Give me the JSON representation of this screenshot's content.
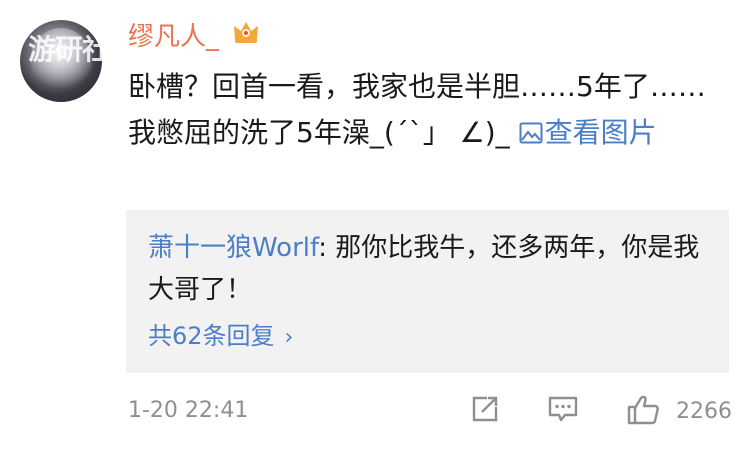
{
  "user": {
    "name": "缪凡人_",
    "watermark": "游研社"
  },
  "comment": {
    "text": "卧槽？回首一看，我家也是半胆……5年了……我憋屈的洗了5年澡_(´`」 ∠)_",
    "view_pic_label": "查看图片"
  },
  "reply": {
    "author": "萧十一狼Worlf",
    "separator": ": ",
    "text": "那你比我牛，还多两年，你是我大哥了！",
    "count_label": "共62条回复",
    "chevron": "›"
  },
  "footer": {
    "timestamp": "1-20 22:41",
    "like_count": "2266"
  },
  "colors": {
    "username": "#eb7350",
    "link": "#4c7ec7",
    "meta": "#8f8f8f",
    "reply_bg": "#f2f2f2"
  },
  "icons": [
    "crown-icon",
    "picture-icon",
    "repost-icon",
    "comment-icon",
    "like-icon"
  ]
}
